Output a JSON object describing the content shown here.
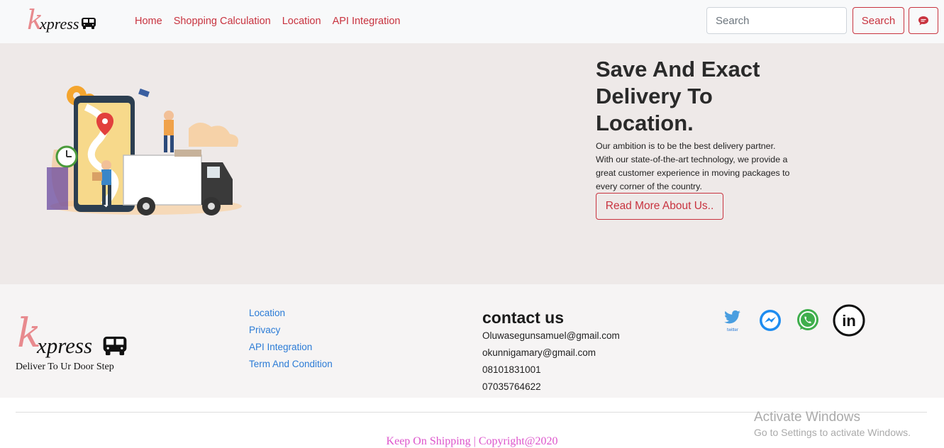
{
  "brand": {
    "k": "k",
    "name": "xpress",
    "tagline": "Deliver To Ur Door Step"
  },
  "nav": {
    "links": [
      "Home",
      "Shopping Calculation",
      "Location",
      "API Integration"
    ],
    "search_placeholder": "Search",
    "search_button": "Search",
    "chat_icon": "chat-bubble-icon"
  },
  "hero": {
    "title": "Save And Exact Delivery To Location.",
    "text": "Our ambition is to be the best delivery partner. With our state-of-the-art technology, we provide a great customer experience in moving packages to every corner of the country.",
    "button": "Read More About Us.."
  },
  "footer": {
    "links": [
      "Location",
      "Privacy",
      "API Integration",
      "Term And Condition"
    ],
    "contact_title": "contact us",
    "contacts": [
      "Oluwasegunsamuel@gmail.com",
      "okunnigamary@gmail.com",
      "08101831001",
      "07035764622"
    ],
    "social": [
      {
        "name": "twitter-icon",
        "label": "twitter"
      },
      {
        "name": "messenger-icon"
      },
      {
        "name": "whatsapp-icon"
      },
      {
        "name": "linkedin-icon",
        "label": "in"
      }
    ]
  },
  "copyright": "Keep On Shipping | Copyright@2020",
  "watermark": {
    "title": "Activate Windows",
    "subtitle": "Go to Settings to activate Windows."
  },
  "colors": {
    "accent": "#c8333f",
    "hero_bg": "#eee9e8",
    "link_blue": "#2b7bd6",
    "copyright_pink": "#dd55cc"
  }
}
